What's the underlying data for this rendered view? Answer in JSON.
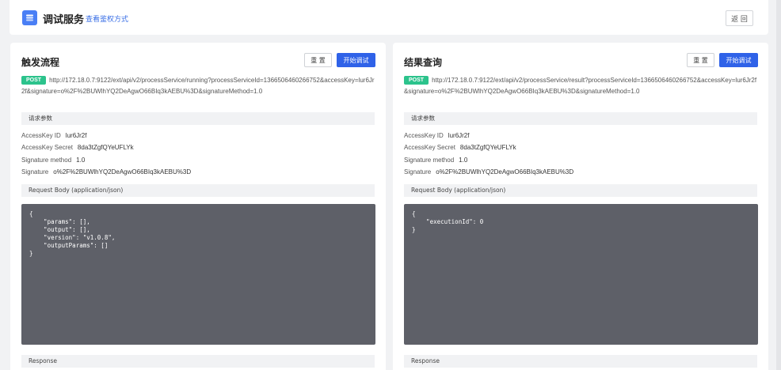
{
  "header": {
    "title": "调试服务",
    "auth_link": "查看鉴权方式",
    "back_label": "返 回"
  },
  "colors": {
    "accent": "#2f62e8",
    "post_badge": "#2cc38c",
    "code_bg": "#5e6068",
    "page_bg": "#f1f2f4"
  },
  "left": {
    "title": "触发流程",
    "reset_label": "重 置",
    "start_label": "开始调试",
    "method": "POST",
    "url": "http://172.18.0.7:9122/ext/api/v2/processService/running?processServiceId=1366506460266752&accessKey=lur6Jr2f&signature=o%2F%2BUWlhYQ2DeAgwO66BIq3kAEBU%3D&signatureMethod=1.0",
    "params_title": "请求参数",
    "params": [
      {
        "label": "AccessKey ID",
        "value": "lur6Jr2f"
      },
      {
        "label": "AccessKey Secret",
        "value": "8da3tZgfQYeUFLYk"
      },
      {
        "label": "Signature method",
        "value": "1.0"
      },
      {
        "label": "Signature",
        "value": "o%2F%2BUWlhYQ2DeAgwO66BIq3kAEBU%3D"
      }
    ],
    "body_title": "Request Body (application/json)",
    "body": "{\n    \"params\": [],\n    \"output\": [],\n    \"version\": \"v1.0.8\",\n    \"outputParams\": []\n}",
    "response_title": "Response"
  },
  "right": {
    "title": "结果查询",
    "reset_label": "重 置",
    "start_label": "开始调试",
    "method": "POST",
    "url": "http://172.18.0.7:9122/ext/api/v2/processService/result?processServiceId=1366506460266752&accessKey=lur6Jr2f&signature=o%2F%2BUWlhYQ2DeAgwO66BIq3kAEBU%3D&signatureMethod=1.0",
    "params_title": "请求参数",
    "params": [
      {
        "label": "AccessKey ID",
        "value": "lur6Jr2f"
      },
      {
        "label": "AccessKey Secret",
        "value": "8da3tZgfQYeUFLYk"
      },
      {
        "label": "Signature method",
        "value": "1.0"
      },
      {
        "label": "Signature",
        "value": "o%2F%2BUWlhYQ2DeAgwO66BIq3kAEBU%3D"
      }
    ],
    "body_title": "Request Body (application/json)",
    "body": "{\n    \"executionId\": 0\n}",
    "response_title": "Response"
  }
}
